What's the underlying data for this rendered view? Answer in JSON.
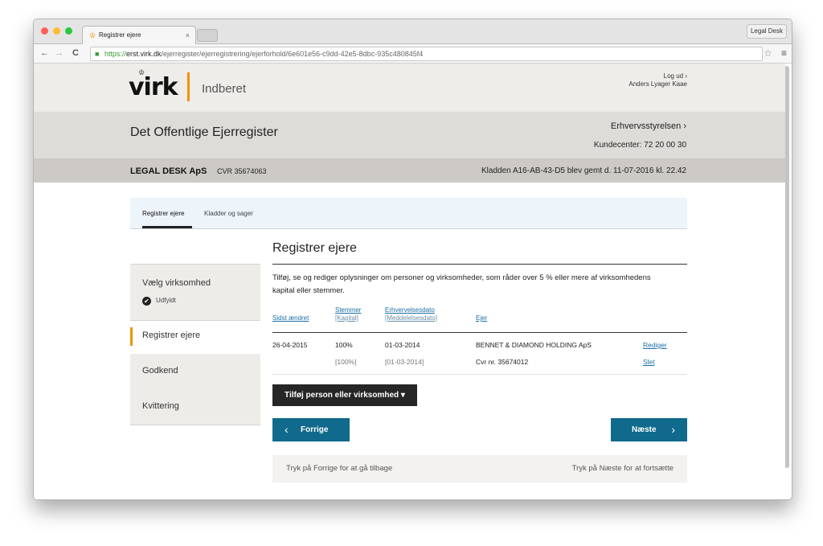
{
  "browser": {
    "tab_title": "Registrer ejere",
    "tab_close": "×",
    "profile_label": "Legal Desk",
    "url_protocol": "https://",
    "url_host": "erst.virk.dk",
    "url_path": "/ejerregister/ejerregistrering/ejerforhold/6e601e56-c9dd-42e5-8dbc-935c480845f4",
    "back": "←",
    "forward": "→",
    "reload": "C",
    "star": "☆",
    "menu": "≡",
    "lock": "🔒",
    "favicon": "♔",
    "colors": {
      "close": "#fe5f57",
      "minimize": "#febc2e",
      "zoom": "#28c840"
    }
  },
  "header": {
    "logo_text": "virk",
    "logo_crown": "♔",
    "logo_subtitle": "Indberet",
    "logout_label": "Log ud ›",
    "user_name": "Anders Lyager Kaae"
  },
  "register": {
    "title": "Det Offentlige Ejerregister",
    "authority": "Erhvervsstyrelsen ›",
    "customer_center": "Kundecenter: 72 20 00 30"
  },
  "company": {
    "name": "LEGAL DESK ApS",
    "cvr": "CVR 35674063",
    "draft_status": "Kladden A16-AB-43-D5 blev gemt d. 11-07-2016 kl. 22.42"
  },
  "tabs": [
    {
      "label": "Registrer ejere"
    },
    {
      "label": "Kladder og sager"
    }
  ],
  "steps": [
    {
      "label": "Vælg virksomhed",
      "status": "Udfyldt",
      "status_icon": "✔"
    },
    {
      "label": "Registrer ejere"
    },
    {
      "label": "Godkend"
    },
    {
      "label": "Kvittering"
    }
  ],
  "main": {
    "title": "Registrer ejere",
    "intro": "Tilføj, se og rediger oplysninger om personer og virksomheder, som råder over 5 % eller mere af virksomhedens kapital eller stemmer."
  },
  "table": {
    "headers": {
      "last_changed": "Sidst ændret",
      "votes": "Stemmer",
      "capital": "[Kapital]",
      "acquired": "Erhvervelsesdato",
      "notified": "[Meddelelsesdato]",
      "owner": "Ejer"
    },
    "rows": [
      {
        "last_changed": "26-04-2015",
        "votes": "100%",
        "capital": "[100%]",
        "acquired": "01-03-2014",
        "notified": "[01-03-2014]",
        "owner": "BENNET & DIAMOND HOLDING ApS",
        "owner_cvr": "Cvr nr. 35674012",
        "edit": "Rediger",
        "delete": "Slet"
      }
    ]
  },
  "actions": {
    "add": "Tilføj person eller virksomhed",
    "add_caret": "▾",
    "prev": "Forrige",
    "next": "Næste",
    "prev_arrow": "‹",
    "next_arrow": "›",
    "prev_hint": "Tryk på Forrige for at gå tilbage",
    "next_hint": "Tryk på Næste for at fortsætte"
  }
}
